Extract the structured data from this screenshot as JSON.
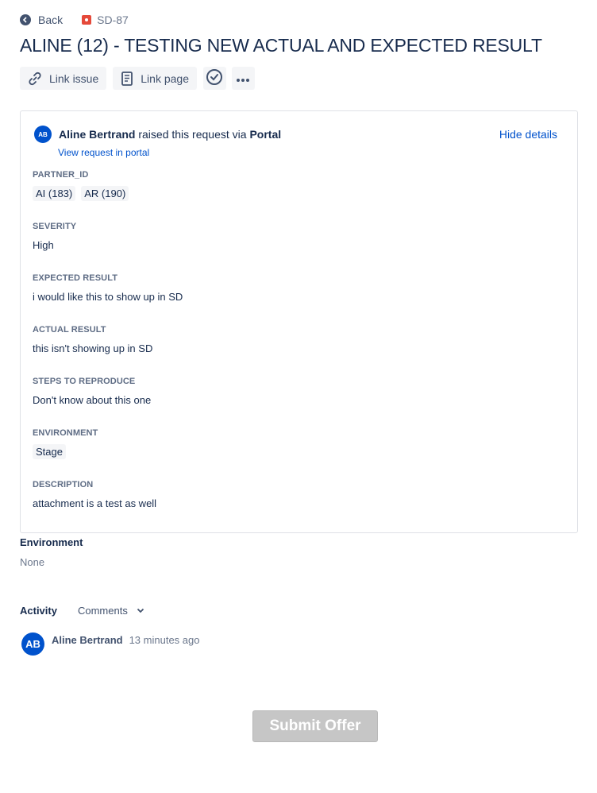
{
  "nav": {
    "back_label": "Back",
    "issue_key": "SD-87"
  },
  "title": "ALINE (12) - TESTING NEW ACTUAL AND EXPECTED RESULT",
  "toolbar": {
    "link_issue": "Link issue",
    "link_page": "Link page"
  },
  "request": {
    "avatar_initials": "AB",
    "reporter": "Aline Bertrand",
    "raised_text": " raised this request via ",
    "channel": "Portal",
    "view_link": "View request in portal",
    "hide_details": "Hide details"
  },
  "fields": {
    "partner_id": {
      "label": "PARTNER_ID",
      "values": [
        "AI (183)",
        "AR (190)"
      ]
    },
    "severity": {
      "label": "SEVERITY",
      "value": "High"
    },
    "expected": {
      "label": "EXPECTED RESULT",
      "value": "i would like this to show up in SD"
    },
    "actual": {
      "label": "ACTUAL RESULT",
      "value": "this isn't showing up in SD"
    },
    "steps": {
      "label": "STEPS TO REPRODUCE",
      "value": "Don't know about this one"
    },
    "environment": {
      "label": "ENVIRONMENT",
      "value": "Stage"
    },
    "description": {
      "label": "DESCRIPTION",
      "value": "attachment is a test as well"
    }
  },
  "environment_section": {
    "heading": "Environment",
    "value": "None"
  },
  "activity": {
    "label": "Activity",
    "filter": "Comments"
  },
  "comment": {
    "avatar_initials": "AB",
    "author": "Aline Bertrand",
    "time": "13 minutes ago"
  },
  "submit_label": "Submit Offer",
  "icons": [
    "back-arrow-icon",
    "bug-icon",
    "link-icon",
    "page-icon",
    "check-circle-icon",
    "more-icon",
    "chevron-down-icon"
  ]
}
